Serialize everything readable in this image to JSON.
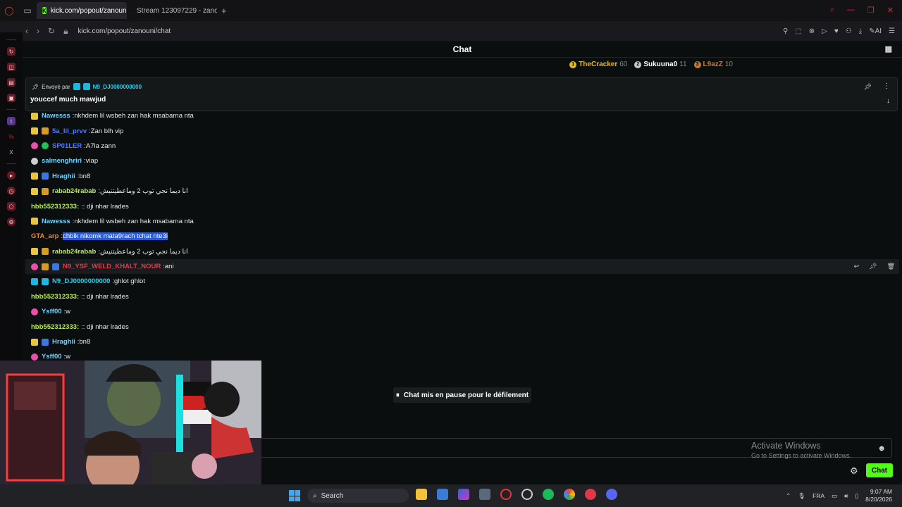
{
  "browser": {
    "tabs": [
      {
        "label": "kick.com/popout/zanouni/c",
        "active": true
      },
      {
        "label": "Stream 123097229 - zanou",
        "active": false
      }
    ],
    "url": "kick.com/popout/zanouni/chat"
  },
  "chat": {
    "title": "Chat",
    "leaderboard": [
      {
        "name": "TheCracker",
        "score": "60",
        "rank": "1",
        "color": "#e8b820"
      },
      {
        "name": "Sukuuna0",
        "score": "11",
        "rank": "2",
        "color": "#c8c8c8"
      },
      {
        "name": "L9azZ",
        "score": "10",
        "rank": "3",
        "color": "#c97a2f"
      }
    ],
    "pinned": {
      "sent_by_label": "Envoyé par",
      "user": "N9_DJ0000000000",
      "message": "youccef much mawjud"
    },
    "messages": [
      {
        "badges": [
          "b-sub"
        ],
        "user": "Nawesss",
        "color": "#6fd3ff",
        "text": "nkhdem lil wsbeh zan hak msabarna nta"
      },
      {
        "badges": [
          "b-sub",
          "b-gold"
        ],
        "user": "5a_lil_prvv",
        "color": "#4c7cff",
        "text": "Zan blh vip"
      },
      {
        "badges": [
          "b-pink",
          "b-green"
        ],
        "user": "SP01LER",
        "color": "#4c7cff",
        "text": "A7la zann"
      },
      {
        "badges": [
          "b-grey"
        ],
        "user": "salmenghriri",
        "color": "#6fd3ff",
        "text": "viap"
      },
      {
        "badges": [
          "b-sub",
          "b-blue"
        ],
        "user": "Hraghii",
        "color": "#6fd3ff",
        "text": "bn8"
      },
      {
        "badges": [
          "b-sub",
          "b-gold"
        ],
        "user": "rabab24rabab",
        "color": "#b6f04a",
        "text": "انا ديما نجي توب 2 وماعطيتنيش"
      },
      {
        "badges": [],
        "user": "hbb552312333:",
        "color": "#b6f04a",
        "text": ": dji nhar lrades"
      },
      {
        "badges": [
          "b-sub"
        ],
        "user": "Nawesss",
        "color": "#6fd3ff",
        "text": "nkhdem lil wsbeh zan hak msabarna nta"
      },
      {
        "badges": [],
        "user": "GTA_arp",
        "color": "#e98a3a",
        "text": "chbik nikomk mata9rach tchat nte3i",
        "highlight": true
      },
      {
        "badges": [
          "b-sub",
          "b-gold"
        ],
        "user": "rabab24rabab",
        "color": "#b6f04a",
        "text": "انا ديما نجي توب 2 وماعطيتنيش"
      },
      {
        "badges": [
          "b-pink",
          "b-gold",
          "b-blue"
        ],
        "user": "N9_YSF_WELD_KHALT_NOUR",
        "color": "#e23b4f",
        "text": "ani",
        "hover": true
      },
      {
        "badges": [
          "b-cyan",
          "b-cyan"
        ],
        "user": "N9_DJ0000000000",
        "color": "#1fd5f0",
        "text": "ghlot ghlot"
      },
      {
        "badges": [],
        "user": "hbb552312333:",
        "color": "#b6f04a",
        "text": ": dji nhar lrades"
      },
      {
        "badges": [
          "b-pink"
        ],
        "user": "Ysff00",
        "color": "#6fd3ff",
        "text": "w"
      },
      {
        "badges": [],
        "user": "hbb552312333:",
        "color": "#b6f04a",
        "text": ": dji nhar lrades"
      },
      {
        "badges": [
          "b-sub",
          "b-blue"
        ],
        "user": "Hraghii",
        "color": "#6fd3ff",
        "text": "bn8"
      },
      {
        "badges": [
          "b-pink"
        ],
        "user": "Ysff00",
        "color": "#6fd3ff",
        "text": "w"
      }
    ],
    "paused_label": "Chat mis en pause pour le défilement",
    "send_label": "Chat"
  },
  "watermark": {
    "title": "Activate Windows",
    "subtitle": "Go to Settings to activate Windows."
  },
  "taskbar": {
    "search_label": "Search",
    "lang": "FRA",
    "time": "9:07 AM",
    "date": "8/20/2026"
  }
}
